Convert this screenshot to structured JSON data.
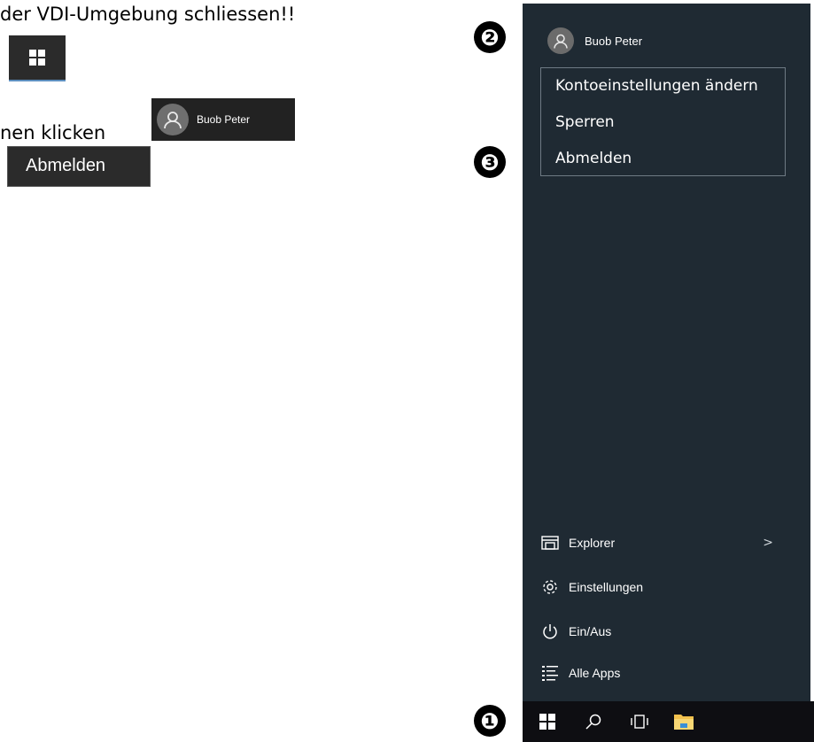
{
  "instructions": {
    "line1": "der VDI-Umgebung schliessen!!",
    "line3": "nen klicken",
    "mini_user_name": "Buob Peter",
    "mini_signout_label": "Abmelden"
  },
  "steps": [
    "❷",
    "❸",
    "❶"
  ],
  "start_menu": {
    "user_name": "Buob Peter",
    "user_popup": [
      "Kontoeinstellungen ändern",
      "Sperren",
      "Abmelden"
    ],
    "items": [
      {
        "label": "Explorer",
        "icon": "explorer-icon",
        "chevron": ">"
      },
      {
        "label": "Einstellungen",
        "icon": "gear-icon"
      },
      {
        "label": "Ein/Aus",
        "icon": "power-icon"
      },
      {
        "label": "Alle Apps",
        "icon": "all-apps-icon"
      }
    ],
    "background": "#1f2a33"
  },
  "taskbar": {
    "icons": [
      "windows-start-icon",
      "search-icon",
      "task-view-icon",
      "file-explorer-icon"
    ],
    "background": "#0e0e12"
  }
}
